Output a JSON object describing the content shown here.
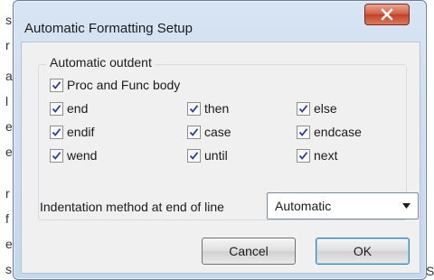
{
  "background_edge": {
    "left_chars": [
      "s",
      "r",
      "a",
      "l",
      "e",
      "e",
      "r",
      "f",
      "e",
      "s"
    ],
    "right_char": "S"
  },
  "window": {
    "title": "Automatic Formatting Setup",
    "close_icon": "close-icon"
  },
  "group": {
    "label": "Automatic outdent",
    "proc_func": {
      "label": "Proc and Func body",
      "checked": true
    },
    "items": [
      {
        "label": "end",
        "checked": true
      },
      {
        "label": "then",
        "checked": true
      },
      {
        "label": "else",
        "checked": true
      },
      {
        "label": "endif",
        "checked": true
      },
      {
        "label": "case",
        "checked": true
      },
      {
        "label": "endcase",
        "checked": true
      },
      {
        "label": "wend",
        "checked": true
      },
      {
        "label": "until",
        "checked": true
      },
      {
        "label": "next",
        "checked": true
      }
    ]
  },
  "indentation": {
    "label": "Indentation method at end of line",
    "value": "Automatic"
  },
  "buttons": {
    "cancel": "Cancel",
    "ok": "OK"
  },
  "colors": {
    "titlebar": "#d7e4f3",
    "client": "#f0f0f0",
    "close_button": "#c24128",
    "checkmark": "#2f3f8f"
  }
}
